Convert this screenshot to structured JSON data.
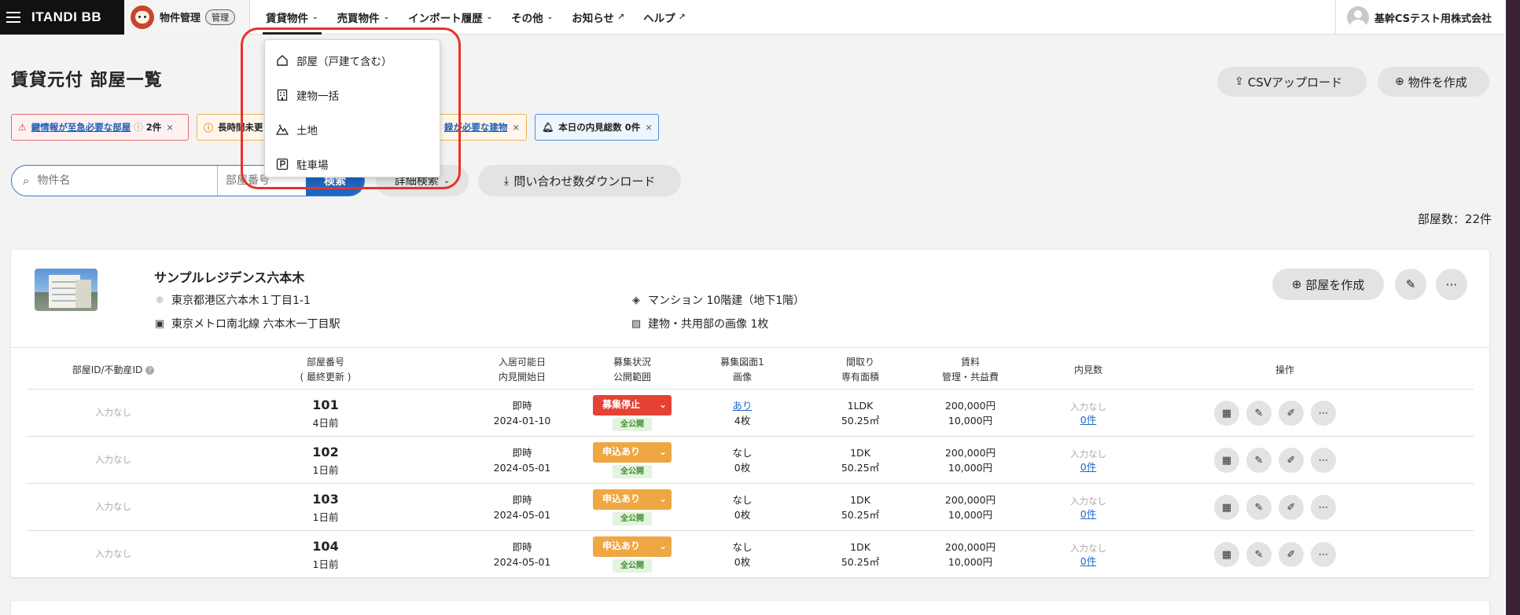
{
  "topnav": {
    "brand": "ITANDI BB",
    "app_name": "物件管理",
    "app_badge": "管理",
    "items": [
      {
        "label": "賃貸物件",
        "chevron": "⌄"
      },
      {
        "label": "売買物件",
        "chevron": "⌄"
      },
      {
        "label": "インポート履歴",
        "chevron": "⌄"
      },
      {
        "label": "その他",
        "chevron": "⌄"
      },
      {
        "label": "お知らせ",
        "ext": "↗"
      },
      {
        "label": "ヘルプ",
        "ext": "↗"
      }
    ],
    "user": "基幹CSテスト用株式会社"
  },
  "dropdown": {
    "items": [
      {
        "label": "部屋（戸建て含む）",
        "icon": "home-icon"
      },
      {
        "label": "建物一括",
        "icon": "building-icon"
      },
      {
        "label": "土地",
        "icon": "land-icon"
      },
      {
        "label": "駐車場",
        "icon": "parking-icon"
      }
    ]
  },
  "page": {
    "title": "賃貸元付 部屋一覧",
    "csv_upload": "CSVアップロード",
    "create_property": "物件を作成"
  },
  "alerts": {
    "red": {
      "link": "鍵情報が至急必要な部屋",
      "count": "2件",
      "close": "×"
    },
    "orange": {
      "prefix": "長時間未更",
      "link": "録が必要な建物",
      "close": "×"
    },
    "blue": {
      "label": "本日の内見総数 0件",
      "close": "×"
    }
  },
  "search": {
    "name_placeholder": "物件名",
    "room_placeholder": "部屋番号",
    "search_button": "検索",
    "detail_button": "詳細検索",
    "download_button": "問い合わせ数ダウンロード"
  },
  "room_count": "部屋数：22件",
  "property": {
    "name": "サンプルレジデンス六本木",
    "address": "東京都港区六本木１丁目1-1",
    "station": "東京メトロ南北線 六本木一丁目駅",
    "building_type": "マンション 10階建（地下1階）",
    "images": "建物・共用部の画像 1枚",
    "create_room": "部屋を作成"
  },
  "table": {
    "headers": [
      {
        "l1": "部屋ID/不動産ID",
        "l2": ""
      },
      {
        "l1": "部屋番号",
        "l2": "( 最終更新 )"
      },
      {
        "l1": "入居可能日",
        "l2": "内見開始日"
      },
      {
        "l1": "募集状況",
        "l2": "公開範囲"
      },
      {
        "l1": "募集図面1",
        "l2": "画像"
      },
      {
        "l1": "間取り",
        "l2": "専有面積"
      },
      {
        "l1": "賃料",
        "l2": "管理・共益費"
      },
      {
        "l1": "内見数",
        "l2": ""
      },
      {
        "l1": "操作",
        "l2": ""
      }
    ],
    "rows": [
      {
        "room_id": "入力なし",
        "room_no": "101",
        "updated": "4日前",
        "move_in": "即時",
        "viewing_start": "2024-01-10",
        "status": "募集停止",
        "status_color": "#e54235",
        "scope": "全公開",
        "drawing": "あり",
        "images": "4枚",
        "layout": "1LDK",
        "area": "50.25㎡",
        "rent": "200,000円",
        "fee": "10,000円",
        "viewing_note": "入力なし",
        "viewing_count": "0件"
      },
      {
        "room_id": "入力なし",
        "room_no": "102",
        "updated": "1日前",
        "move_in": "即時",
        "viewing_start": "2024-05-01",
        "status": "申込あり",
        "status_color": "#efa743",
        "scope": "全公開",
        "drawing": "なし",
        "images": "0枚",
        "layout": "1DK",
        "area": "50.25㎡",
        "rent": "200,000円",
        "fee": "10,000円",
        "viewing_note": "入力なし",
        "viewing_count": "0件"
      },
      {
        "room_id": "入力なし",
        "room_no": "103",
        "updated": "1日前",
        "move_in": "即時",
        "viewing_start": "2024-05-01",
        "status": "申込あり",
        "status_color": "#efa743",
        "scope": "全公開",
        "drawing": "なし",
        "images": "0枚",
        "layout": "1DK",
        "area": "50.25㎡",
        "rent": "200,000円",
        "fee": "10,000円",
        "viewing_note": "入力なし",
        "viewing_count": "0件"
      },
      {
        "room_id": "入力なし",
        "room_no": "104",
        "updated": "1日前",
        "move_in": "即時",
        "viewing_start": "2024-05-01",
        "status": "申込あり",
        "status_color": "#efa743",
        "scope": "全公開",
        "drawing": "なし",
        "images": "0枚",
        "layout": "1DK",
        "area": "50.25㎡",
        "rent": "200,000円",
        "fee": "10,000円",
        "viewing_note": "入力なし",
        "viewing_count": "0件"
      }
    ]
  },
  "colors": {
    "brand_dark": "#111111",
    "accent_blue": "#1c66c4",
    "status_red": "#e54235",
    "status_orange": "#efa743",
    "highlight_red": "#e6342a"
  }
}
